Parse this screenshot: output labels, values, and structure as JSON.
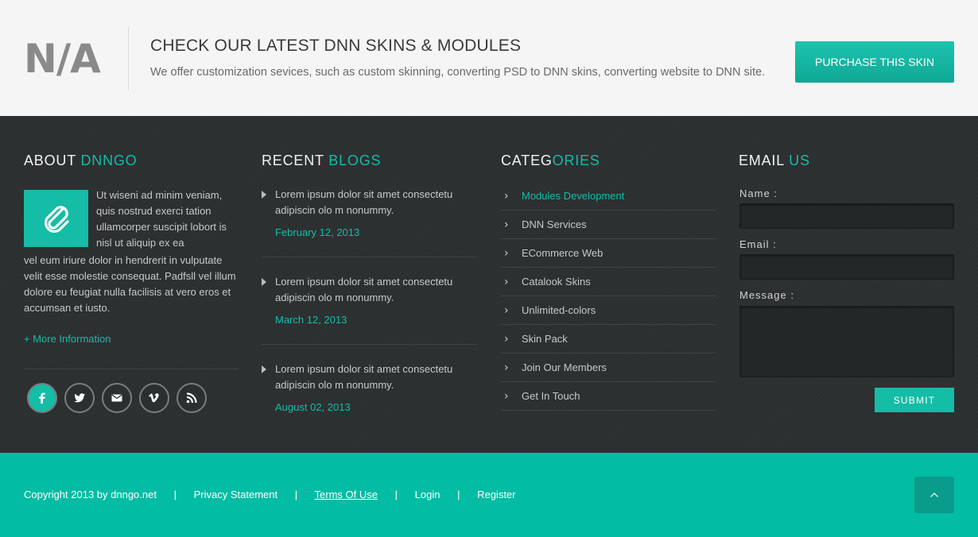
{
  "banner": {
    "logo": "N/A",
    "title": "CHECK OUR LATEST DNN SKINS & MODULES",
    "subtitle": "We offer customization sevices, such as custom skinning, converting PSD to DNN skins, converting website to DNN site.",
    "purchase_label": "PURCHASE THIS SKIN"
  },
  "about": {
    "title_a": "ABOUT ",
    "title_b": "DNNGO",
    "text_1": "Ut wiseni ad minim veniam, quis nostrud exerci tation ullamcorper suscipit lobort is nisl ut aliquip ex ea",
    "text_2": "vel eum iriure dolor in hendrerit in vulputate velit esse molestie consequat. Padfsll vel illum dolore eu feugiat nulla facilisis at vero eros et accumsan et iusto.",
    "more_label": "+ More Information",
    "social": [
      "facebook-icon",
      "twitter-icon",
      "mail-icon",
      "vimeo-icon",
      "rss-icon"
    ]
  },
  "blogs": {
    "title_a": "RECENT ",
    "title_b": "BLOGS",
    "items": [
      {
        "text": "Lorem ipsum dolor sit amet consectetu adipiscin olo m nonummy.",
        "date": "February 12, 2013"
      },
      {
        "text": "Lorem ipsum dolor sit amet consectetu adipiscin olo m nonummy.",
        "date": "March 12, 2013"
      },
      {
        "text": "Lorem ipsum dolor sit amet consectetu adipiscin olo m nonummy.",
        "date": "August  02, 2013"
      }
    ]
  },
  "categories": {
    "title_a": "CATEG",
    "title_b": "ORIES",
    "items": [
      {
        "label": "Modules Development"
      },
      {
        "label": "DNN Services"
      },
      {
        "label": "ECommerce Web"
      },
      {
        "label": "Catalook Skins"
      },
      {
        "label": "Unlimited-colors"
      },
      {
        "label": "Skin Pack"
      },
      {
        "label": "Join Our Members"
      },
      {
        "label": "Get In Touch"
      }
    ]
  },
  "email": {
    "title_a": "EMAIL ",
    "title_b": "US",
    "name_label": "Name :",
    "email_label": "Email :",
    "message_label": "Message :",
    "submit_label": "SUBMIT"
  },
  "footer": {
    "copyright": "Copyright 2013 by dnngo.net",
    "separator": "|",
    "privacy": "Privacy Statement",
    "terms": "Terms Of Use",
    "login": "Login",
    "register": "Register"
  },
  "colors": {
    "accent": "#15bca6",
    "dark_bg": "#2b2f30",
    "bottom_bar": "#03bca4"
  }
}
